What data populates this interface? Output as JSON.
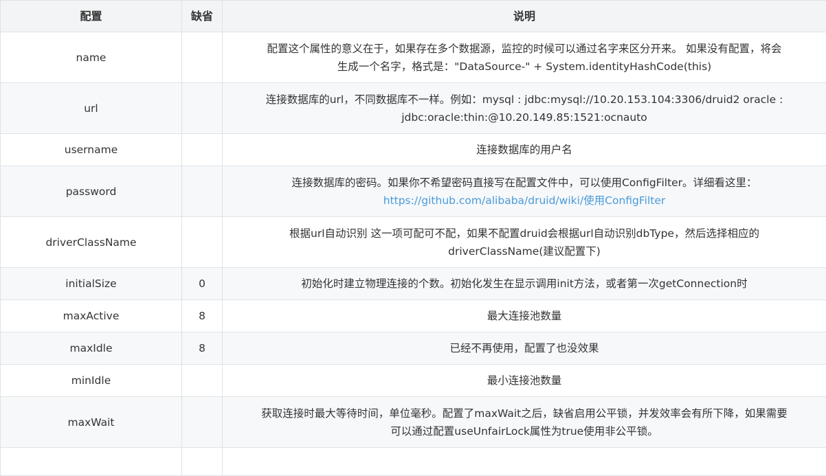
{
  "headers": {
    "name": "配置",
    "default": "缺省",
    "desc": "说明"
  },
  "rows": [
    {
      "name": "name",
      "default": "",
      "desc_line1": "配置这个属性的意义在于，如果存在多个数据源，监控的时候可以通过名字来区分开来。 如果没有配置，将会",
      "desc_line2": "生成一个名字，格式是：\"DataSource-\" + System.identityHashCode(this)"
    },
    {
      "name": "url",
      "default": "",
      "desc_line1": "连接数据库的url，不同数据库不一样。例如：mysql : jdbc:mysql://10.20.153.104:3306/druid2 oracle :",
      "desc_line2": "jdbc:oracle:thin:@10.20.149.85:1521:ocnauto"
    },
    {
      "name": "username",
      "default": "",
      "desc_line1": "连接数据库的用户名"
    },
    {
      "name": "password",
      "default": "",
      "desc_line1": "连接数据库的密码。如果你不希望密码直接写在配置文件中，可以使用ConfigFilter。详细看这里：",
      "link": "https://github.com/alibaba/druid/wiki/使用ConfigFilter"
    },
    {
      "name": "driverClassName",
      "default": "",
      "desc_line1": "根据url自动识别 这一项可配可不配，如果不配置druid会根据url自动识别dbType，然后选择相应的",
      "desc_line2": "driverClassName(建议配置下)"
    },
    {
      "name": "initialSize",
      "default": "0",
      "desc_line1": "初始化时建立物理连接的个数。初始化发生在显示调用init方法，或者第一次getConnection时"
    },
    {
      "name": "maxActive",
      "default": "8",
      "desc_line1": "最大连接池数量"
    },
    {
      "name": "maxIdle",
      "default": "8",
      "desc_line1": "已经不再使用，配置了也没效果"
    },
    {
      "name": "minIdle",
      "default": "",
      "desc_line1": "最小连接池数量"
    },
    {
      "name": "maxWait",
      "default": "",
      "desc_line1": "获取连接时最大等待时间，单位毫秒。配置了maxWait之后，缺省启用公平锁，并发效率会有所下降，如果需要",
      "desc_line2": "可以通过配置useUnfairLock属性为true使用非公平锁。"
    }
  ]
}
